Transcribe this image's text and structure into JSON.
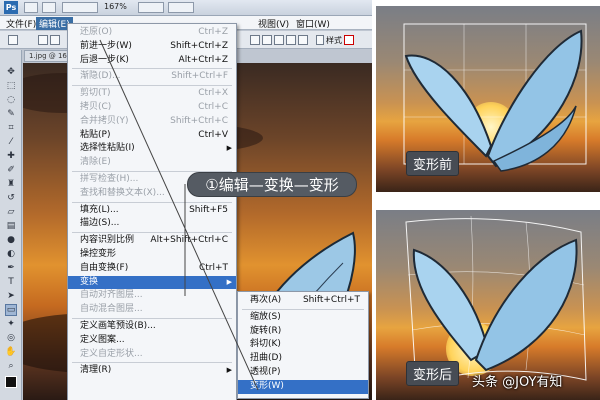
{
  "app": {
    "logo": "Ps",
    "zoom": "167%",
    "menubar": [
      "文件(F)",
      "编辑(E)",
      "视图(V)",
      "窗口(W)"
    ],
    "doc_tab": "1.jpg @ 167"
  },
  "options_bar": {
    "style_label": "样式",
    "icons": [
      "move-icon",
      "link-icon",
      "align-icon"
    ]
  },
  "edit_menu": {
    "items": [
      {
        "label": "还原(O)",
        "shortcut": "Ctrl+Z",
        "disabled": true
      },
      {
        "label": "前进一步(W)",
        "shortcut": "Shift+Ctrl+Z",
        "disabled": false
      },
      {
        "label": "后退一步(K)",
        "shortcut": "Alt+Ctrl+Z",
        "disabled": false
      },
      {
        "sep": true
      },
      {
        "label": "渐隐(D)...",
        "shortcut": "Shift+Ctrl+F",
        "disabled": true
      },
      {
        "sep": true
      },
      {
        "label": "剪切(T)",
        "shortcut": "Ctrl+X",
        "disabled": true
      },
      {
        "label": "拷贝(C)",
        "shortcut": "Ctrl+C",
        "disabled": true
      },
      {
        "label": "合并拷贝(Y)",
        "shortcut": "Shift+Ctrl+C",
        "disabled": true
      },
      {
        "label": "粘贴(P)",
        "shortcut": "Ctrl+V",
        "disabled": false
      },
      {
        "label": "选择性粘贴(I)",
        "shortcut": "",
        "disabled": false,
        "submenu": true
      },
      {
        "label": "清除(E)",
        "shortcut": "",
        "disabled": true
      },
      {
        "sep": true
      },
      {
        "label": "拼写检查(H)...",
        "shortcut": "",
        "disabled": true
      },
      {
        "label": "查找和替换文本(X)...",
        "shortcut": "",
        "disabled": true
      },
      {
        "sep": true
      },
      {
        "label": "填充(L)...",
        "shortcut": "Shift+F5",
        "disabled": false
      },
      {
        "label": "描边(S)...",
        "shortcut": "",
        "disabled": false
      },
      {
        "sep": true
      },
      {
        "label": "内容识别比例",
        "shortcut": "Alt+Shift+Ctrl+C",
        "disabled": false
      },
      {
        "label": "操控变形",
        "shortcut": "",
        "disabled": false
      },
      {
        "label": "自由变换(F)",
        "shortcut": "Ctrl+T",
        "disabled": false
      },
      {
        "label": "变换",
        "shortcut": "",
        "disabled": false,
        "submenu": true,
        "highlight": true
      },
      {
        "label": "自动对齐图层...",
        "shortcut": "",
        "disabled": true
      },
      {
        "label": "自动混合图层...",
        "shortcut": "",
        "disabled": true
      },
      {
        "sep": true
      },
      {
        "label": "定义画笔预设(B)...",
        "shortcut": "",
        "disabled": false
      },
      {
        "label": "定义图案...",
        "shortcut": "",
        "disabled": false
      },
      {
        "label": "定义自定形状...",
        "shortcut": "",
        "disabled": true
      },
      {
        "sep": true
      },
      {
        "label": "清理(R)",
        "shortcut": "",
        "disabled": false,
        "submenu": true
      }
    ]
  },
  "transform_submenu": {
    "items": [
      {
        "label": "再次(A)",
        "shortcut": "Shift+Ctrl+T",
        "highlight": false
      },
      {
        "sep": true
      },
      {
        "label": "缩放(S)",
        "shortcut": "",
        "highlight": false
      },
      {
        "label": "旋转(R)",
        "shortcut": "",
        "highlight": false
      },
      {
        "label": "斜切(K)",
        "shortcut": "",
        "highlight": false
      },
      {
        "label": "扭曲(D)",
        "shortcut": "",
        "highlight": false
      },
      {
        "label": "透视(P)",
        "shortcut": "",
        "highlight": false
      },
      {
        "label": "变形(W)",
        "shortcut": "",
        "highlight": true
      }
    ]
  },
  "callout": "①编辑—变换—变形",
  "before_label": "变形前",
  "after_label": "变形后",
  "watermark": "头条 @JOY有知",
  "colors": {
    "menu_highlight": "#3470c6",
    "callout_bg": "#555b63"
  }
}
